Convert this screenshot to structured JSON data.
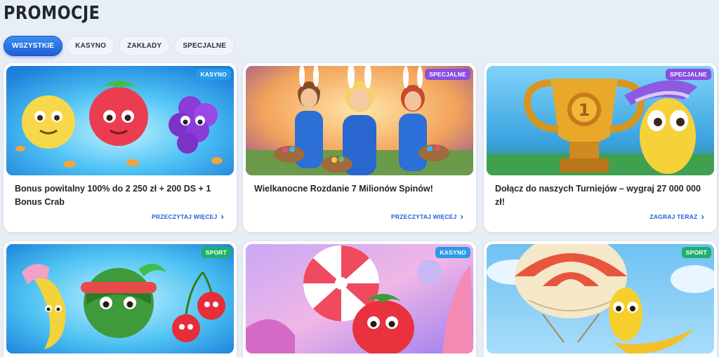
{
  "page": {
    "title": "PROMOCJE"
  },
  "filters": [
    {
      "label": "WSZYSTKIE",
      "active": true
    },
    {
      "label": "KASYNO",
      "active": false
    },
    {
      "label": "ZAKŁADY",
      "active": false
    },
    {
      "label": "SPECJALNE",
      "active": false
    }
  ],
  "colors": {
    "accent": "#1f5fd8",
    "badge_kasyno": "#2a9be8",
    "badge_specjalne": "#8a4fe0",
    "badge_sport": "#20b06a"
  },
  "cards": [
    {
      "badge": "KASYNO",
      "title": "Bonus powitalny 100% do 2 250 zł + 200 DS + 1 Bonus Crab",
      "cta": "PRZECZYTAJ WIĘCEJ",
      "art": "fruits"
    },
    {
      "badge": "SPECJALNE",
      "title": "Wielkanocne Rozdanie 7 Milionów Spinów!",
      "cta": "PRZECZYTAJ WIĘCEJ",
      "art": "easter"
    },
    {
      "badge": "SPECJALNE",
      "title": "Dołącz do naszych Turniejów – wygraj 27 000 000 zł!",
      "cta": "ZAGRAJ TERAZ",
      "art": "trophy"
    },
    {
      "badge": "SPORT",
      "title": "",
      "cta": "",
      "art": "fruits-sport"
    },
    {
      "badge": "KASYNO",
      "title": "",
      "cta": "",
      "art": "candy"
    },
    {
      "badge": "SPORT",
      "title": "",
      "cta": "",
      "art": "balloon"
    }
  ]
}
